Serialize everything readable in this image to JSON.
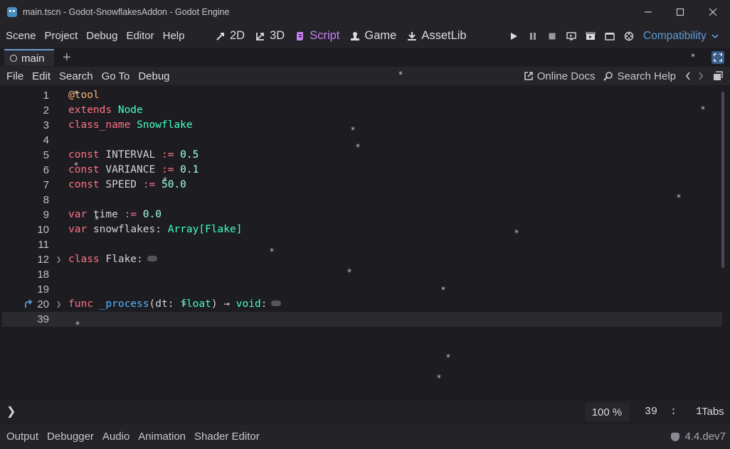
{
  "window": {
    "title": "main.tscn - Godot-SnowflakesAddon - Godot Engine",
    "controls": [
      "minimize",
      "maximize",
      "close"
    ]
  },
  "menubar": {
    "items": [
      "Scene",
      "Project",
      "Debug",
      "Editor",
      "Help"
    ],
    "modes": [
      {
        "label": "2D",
        "icon": "2d-icon"
      },
      {
        "label": "3D",
        "icon": "3d-icon"
      },
      {
        "label": "Script",
        "icon": "script-icon",
        "active": true
      },
      {
        "label": "Game",
        "icon": "game-icon"
      },
      {
        "label": "AssetLib",
        "icon": "assetlib-icon"
      }
    ],
    "renderer": "Compatibility"
  },
  "scene_tabs": {
    "tabs": [
      "main"
    ]
  },
  "script_menu": {
    "items": [
      "File",
      "Edit",
      "Search",
      "Go To",
      "Debug"
    ],
    "online_docs": "Online Docs",
    "search_help": "Search Help"
  },
  "code": {
    "lines": [
      {
        "num": "1"
      },
      {
        "num": "2"
      },
      {
        "num": "3"
      },
      {
        "num": "4"
      },
      {
        "num": "5"
      },
      {
        "num": "6"
      },
      {
        "num": "7"
      },
      {
        "num": "8"
      },
      {
        "num": "9"
      },
      {
        "num": "10"
      },
      {
        "num": "11"
      },
      {
        "num": "12"
      },
      {
        "num": "18"
      },
      {
        "num": "19"
      },
      {
        "num": "20"
      },
      {
        "num": "39"
      }
    ],
    "tokens": {
      "l1_tool": "@tool",
      "l2_extends": "extends",
      "l2_node": "Node",
      "l3_classname": "class_name",
      "l3_snowflake": "Snowflake",
      "l5_const": "const",
      "l5_name": "INTERVAL",
      "l5_op": ":=",
      "l5_val": "0.5",
      "l6_const": "const",
      "l6_name": "VARIANCE",
      "l6_op": ":=",
      "l6_val": "0.1",
      "l7_const": "const",
      "l7_name": "SPEED",
      "l7_op": ":=",
      "l7_val": "50.0",
      "l9_var": "var",
      "l9_name": "time",
      "l9_op": ":=",
      "l9_val": "0.0",
      "l10_var": "var",
      "l10_name": "snowflakes:",
      "l10_type": "Array[Flake]",
      "l12_class": "class",
      "l12_name": "Flake:",
      "l20_func": "func",
      "l20_name": "_process",
      "l20_param": "(dt: ",
      "l20_type": "float",
      "l20_rest": ")",
      "l20_arrow": "→",
      "l20_void": "void",
      "l20_colon": ":"
    }
  },
  "status": {
    "zoom": "100 %",
    "line": "39",
    "column": "1",
    "indent": "Tabs"
  },
  "bottom_panel": {
    "tabs": [
      "Output",
      "Debugger",
      "Audio",
      "Animation",
      "Shader Editor"
    ],
    "version": "4.4.dev7"
  },
  "colors": {
    "accent": "#c882f2",
    "renderer": "#5f9bd6",
    "keyword": "#ff7085",
    "type": "#42ffc2",
    "annotation": "#ffb373",
    "number": "#a1ffe0",
    "function": "#57b3ff"
  }
}
